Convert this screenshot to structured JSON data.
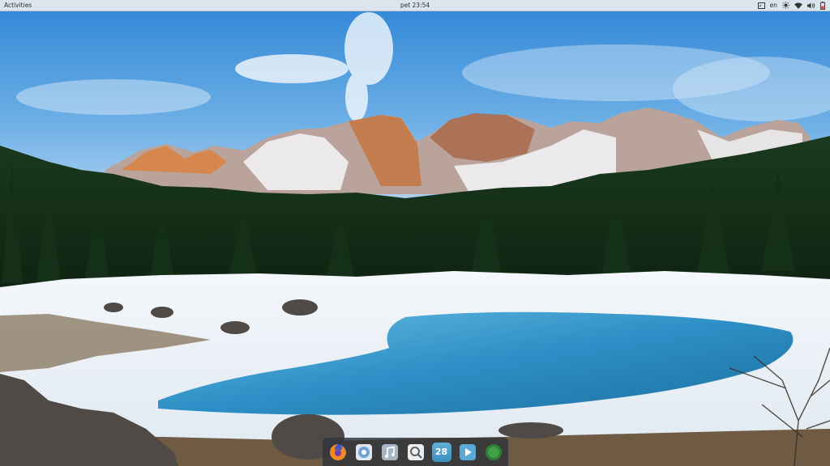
{
  "top_bar": {
    "activities_label": "Activities",
    "clock": "pet 23:54",
    "tray": {
      "keyboard_layout": "en",
      "icons": [
        "screenshot-icon",
        "brightness-icon",
        "wifi-icon",
        "volume-icon",
        "battery-icon"
      ]
    }
  },
  "dock": {
    "apps": [
      {
        "name": "firefox",
        "icon": "firefox-icon"
      },
      {
        "name": "files",
        "icon": "files-icon"
      },
      {
        "name": "music",
        "icon": "music-icon"
      },
      {
        "name": "search",
        "icon": "search-icon"
      },
      {
        "name": "calendar",
        "icon": "calendar-icon",
        "label": "28"
      },
      {
        "name": "videos",
        "icon": "play-icon"
      },
      {
        "name": "system-monitor",
        "icon": "green-circle-icon"
      }
    ]
  },
  "colors": {
    "panel_bg": "#e8ecf0",
    "dock_bg": "#30343a",
    "sky": "#3a8fd8",
    "lake": "#2f8fc4"
  }
}
